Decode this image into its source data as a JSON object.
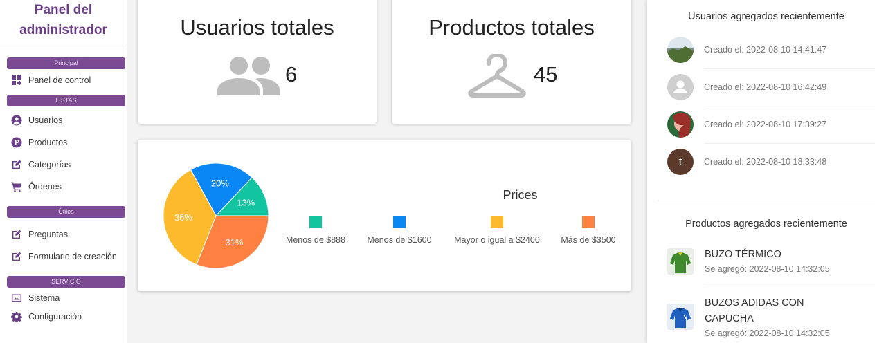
{
  "sidebar": {
    "brand_line1": "Panel del",
    "brand_line2": "administrador",
    "sections": [
      {
        "label": "Principal",
        "items": [
          {
            "label": "Panel de control",
            "icon": "dashboard-icon"
          }
        ]
      },
      {
        "label": "LISTAS",
        "items": [
          {
            "label": "Usuarios",
            "icon": "user-circle-icon"
          },
          {
            "label": "Productos",
            "icon": "product-p-icon"
          },
          {
            "label": "Categorías",
            "icon": "edit-icon"
          },
          {
            "label": "Órdenes",
            "icon": "cart-icon"
          }
        ]
      },
      {
        "label": "Útiles",
        "items": [
          {
            "label": "Preguntas",
            "icon": "edit-icon"
          },
          {
            "label": "Formulario de creación",
            "icon": "edit-icon"
          }
        ]
      },
      {
        "label": "SERVICIO",
        "items": [
          {
            "label": "Sistema",
            "icon": "system-icon"
          },
          {
            "label": "Configuración",
            "icon": "gear-icon"
          }
        ]
      }
    ]
  },
  "stats": {
    "users": {
      "title": "Usuarios totales",
      "value": "6",
      "icon": "people-icon"
    },
    "products": {
      "title": "Productos totales",
      "value": "45",
      "icon": "hanger-icon"
    }
  },
  "chart_data": {
    "type": "pie",
    "title": "Prices",
    "slices": [
      {
        "label": "Menos de $888",
        "value": 13,
        "text": "13%",
        "color": "#13c4a1"
      },
      {
        "label": "Menos de $1600",
        "value": 20,
        "text": "20%",
        "color": "#0b86f5"
      },
      {
        "label": "Mayor o igual a $2400",
        "value": 36,
        "text": "36%",
        "color": "#fdba2c"
      },
      {
        "label": "Más de $3500",
        "value": 31,
        "text": "31%",
        "color": "#fe8142"
      }
    ],
    "legend": [
      "Menos de $888",
      "Menos de $1600",
      "Mayor o igual a $2400",
      "Más de $3500"
    ]
  },
  "recent_users": {
    "title": "Usuarios agregados recientemente",
    "items": [
      {
        "text": "Creado el: 2022-08-10 14:41:47",
        "avatar": "photo-landscape"
      },
      {
        "text": "Creado el: 2022-08-10 16:42:49",
        "avatar": "default"
      },
      {
        "text": "Creado el: 2022-08-10 17:39:27",
        "avatar": "photo-person"
      },
      {
        "text": "Creado el: 2022-08-10 18:33:48",
        "avatar": "letter",
        "letter": "t"
      }
    ]
  },
  "recent_products": {
    "title": "Productos agregados recientemente",
    "items": [
      {
        "name": "BUZO TÉRMICO",
        "date": "Se agregó: 2022-08-10 14:32:05",
        "thumb_color": "#3f8a2e"
      },
      {
        "name": "BUZOS ADIDAS CON CAPUCHA",
        "date": "Se agregó: 2022-08-10 14:32:05",
        "thumb_color": "#1f5fc0"
      }
    ]
  },
  "colors": {
    "brand": "#6b3f87",
    "section": "#7b4a93",
    "icon_gray": "#bdbdbd"
  }
}
